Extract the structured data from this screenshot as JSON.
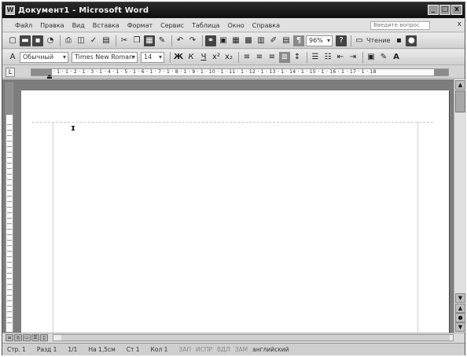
{
  "window": {
    "title": "Документ1 - Microsoft Word",
    "app_icon": "W",
    "min": "_",
    "max": "□",
    "close": "x"
  },
  "menu": {
    "items": [
      "Файл",
      "Правка",
      "Вид",
      "Вставка",
      "Формат",
      "Сервис",
      "Таблица",
      "Окно",
      "Справка"
    ],
    "help_placeholder": "Введите вопрос",
    "close_doc": "x"
  },
  "toolbar_std": {
    "zoom": "96%",
    "read_label": "Чтение"
  },
  "toolbar_fmt": {
    "style": "Обычный",
    "style_prefix": "A",
    "font": "Times New Roman",
    "size": "14"
  },
  "ruler": {
    "ticks": "· 1 · 1 · 2 · 1 · 3 · 1 · 4 · 1 · 5 · 1 · 6 · 1 · 7 · 1 · 8 · 1 · 9 · 1 · 10 · 1 · 11 · 1 · 12 · 1 · 13 · 1 · 14 · 1 · 15 · 1 · 16 · 1 · 17 · 1 · 18"
  },
  "status": {
    "page": "Стр. 1",
    "section": "Разд 1",
    "pages": "1/1",
    "at": "На 1,5см",
    "line": "Ст 1",
    "col": "Кол 1",
    "rec": "ЗАП",
    "trk": "ИСПР",
    "ext": "ВДЛ",
    "ovr": "ЗАМ",
    "lang": "английский"
  }
}
